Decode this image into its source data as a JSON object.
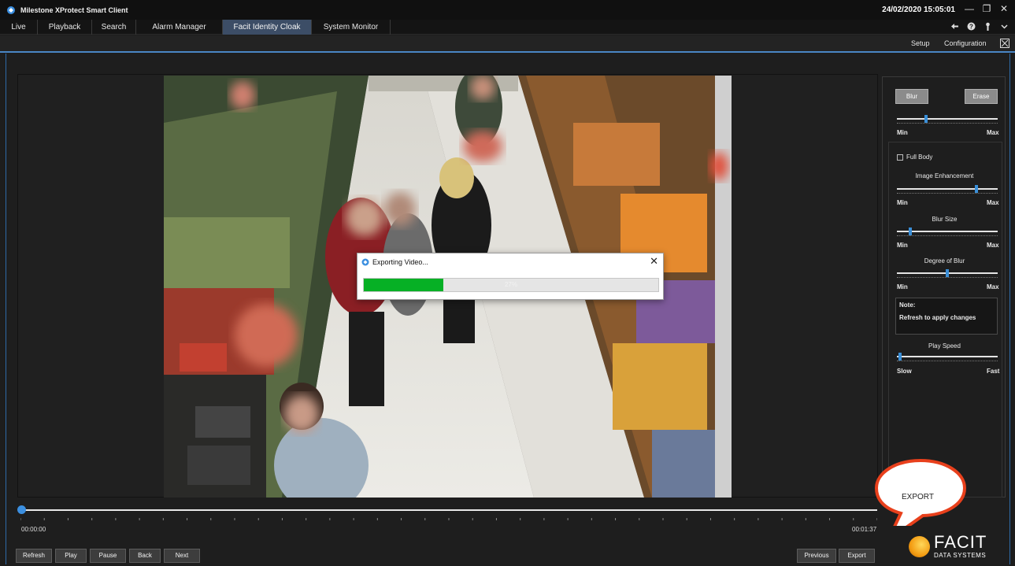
{
  "window": {
    "title": "Milestone XProtect Smart Client",
    "datetime": "24/02/2020 15:05:01",
    "controls": [
      "—",
      "❐",
      "✕"
    ]
  },
  "tabs": [
    {
      "label": "Live"
    },
    {
      "label": "Playback"
    },
    {
      "label": "Search"
    },
    {
      "label": "Alarm Manager"
    },
    {
      "label": "Facit Identity Cloak",
      "active": true
    },
    {
      "label": "System Monitor"
    }
  ],
  "tab_icons": [
    "back-arrow-icon",
    "help-icon",
    "user-icon",
    "chevron-down-icon"
  ],
  "toolbar": {
    "setup": "Setup",
    "configuration": "Configuration"
  },
  "dialog": {
    "title": "Exporting Video...",
    "close": "✕",
    "progress": 0.27,
    "progress_label": "27%"
  },
  "side": {
    "blur_button": "Blur",
    "erase_button": "Erase",
    "intensity": {
      "min": "Min",
      "max": "Max",
      "value": 0.28
    },
    "full_body": "Full Body",
    "image_enhancement": {
      "label": "Image Enhancement",
      "min": "Min",
      "max": "Max",
      "value": 0.8
    },
    "blur_size": {
      "label": "Blur Size",
      "min": "Min",
      "max": "Max",
      "value": 0.12
    },
    "degree_of_blur": {
      "label": "Degree of Blur",
      "min": "Min",
      "max": "Max",
      "value": 0.5
    },
    "note_title": "Note:",
    "note_text": "Refresh to apply changes",
    "play_speed": {
      "label": "Play Speed",
      "min": "Slow",
      "max": "Fast",
      "value": 0.02
    }
  },
  "timeline": {
    "start": "00:00:00",
    "end": "00:01:37",
    "position": 0.0
  },
  "buttons": {
    "refresh": "Refresh",
    "play": "Play",
    "pause": "Pause",
    "back": "Back",
    "next": "Next",
    "previous": "Previous",
    "export": "Export"
  },
  "callout": {
    "text": "EXPORT"
  },
  "logo": {
    "name": "FACIT",
    "sub": "DATA SYSTEMS"
  },
  "colors": {
    "accent": "#3c4d66",
    "progress": "#06b025",
    "callout": "#e8401c",
    "slider_thumb": "#3a8fd8"
  }
}
